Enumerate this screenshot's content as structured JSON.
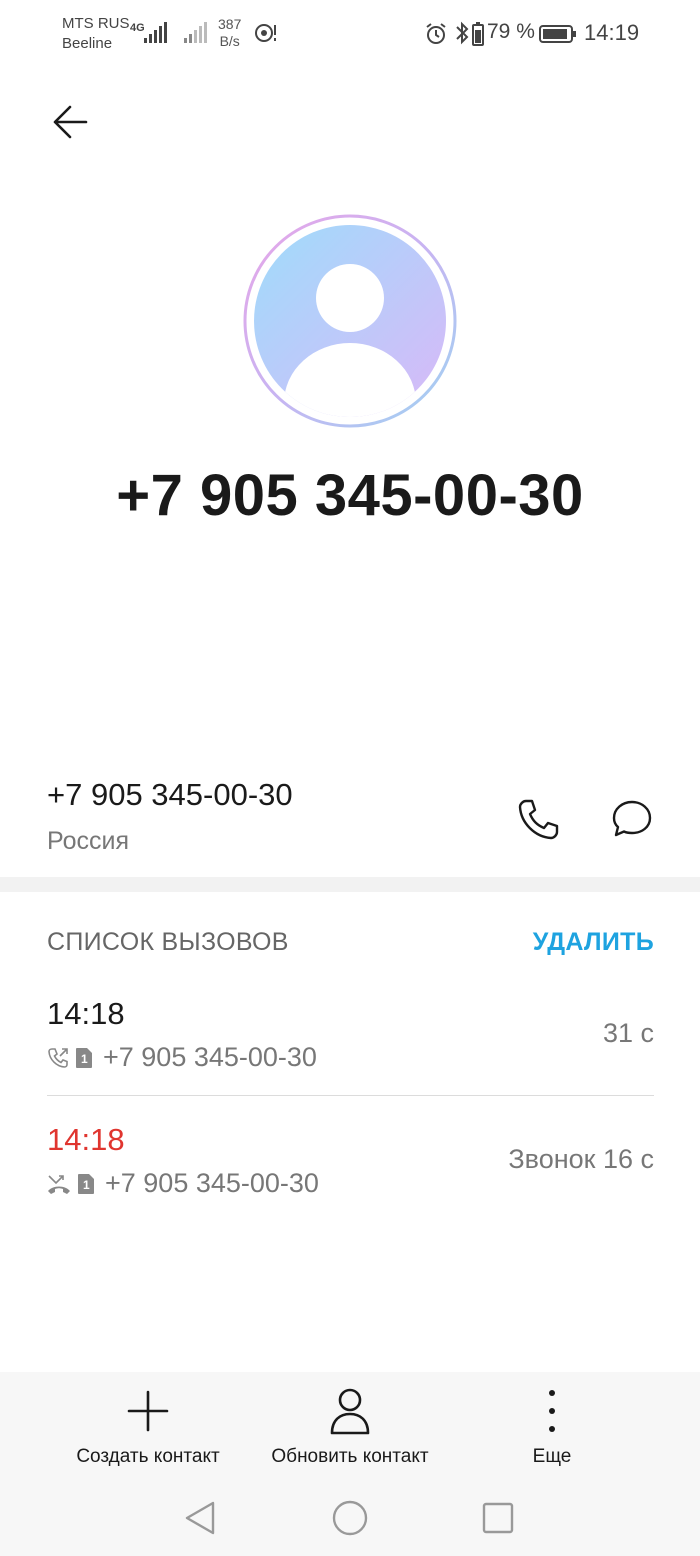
{
  "status_bar": {
    "carrier_1": "MTS RUS",
    "carrier_2": "Beeline",
    "network_type": "4G",
    "speed_value": "387",
    "speed_unit": "B/s",
    "battery_percent": "79 %",
    "time": "14:19"
  },
  "contact": {
    "number_title": "+7 905 345-00-30",
    "number": "+7 905 345-00-30",
    "region": "Россия"
  },
  "call_list": {
    "header": "СПИСОК ВЫЗОВОВ",
    "delete_label": "УДАЛИТЬ",
    "entries": [
      {
        "time": "14:18",
        "number": "+7 905 345-00-30",
        "duration": "31 с",
        "type": "outgoing",
        "sim": "1"
      },
      {
        "time": "14:18",
        "number": "+7 905 345-00-30",
        "duration": "Звонок 16 с",
        "type": "missed",
        "sim": "1"
      }
    ]
  },
  "actions": {
    "create_contact": "Создать контакт",
    "update_contact": "Обновить контакт",
    "more": "Еще"
  },
  "colors": {
    "accent": "#1ea3e0",
    "missed": "#e0352f",
    "text_primary": "#1a1a1a",
    "text_secondary": "#777777"
  },
  "icons": {
    "back": "arrow-left-icon",
    "call": "phone-icon",
    "message": "message-bubble-icon",
    "add": "plus-icon",
    "person": "person-icon",
    "more": "more-vertical-icon"
  }
}
